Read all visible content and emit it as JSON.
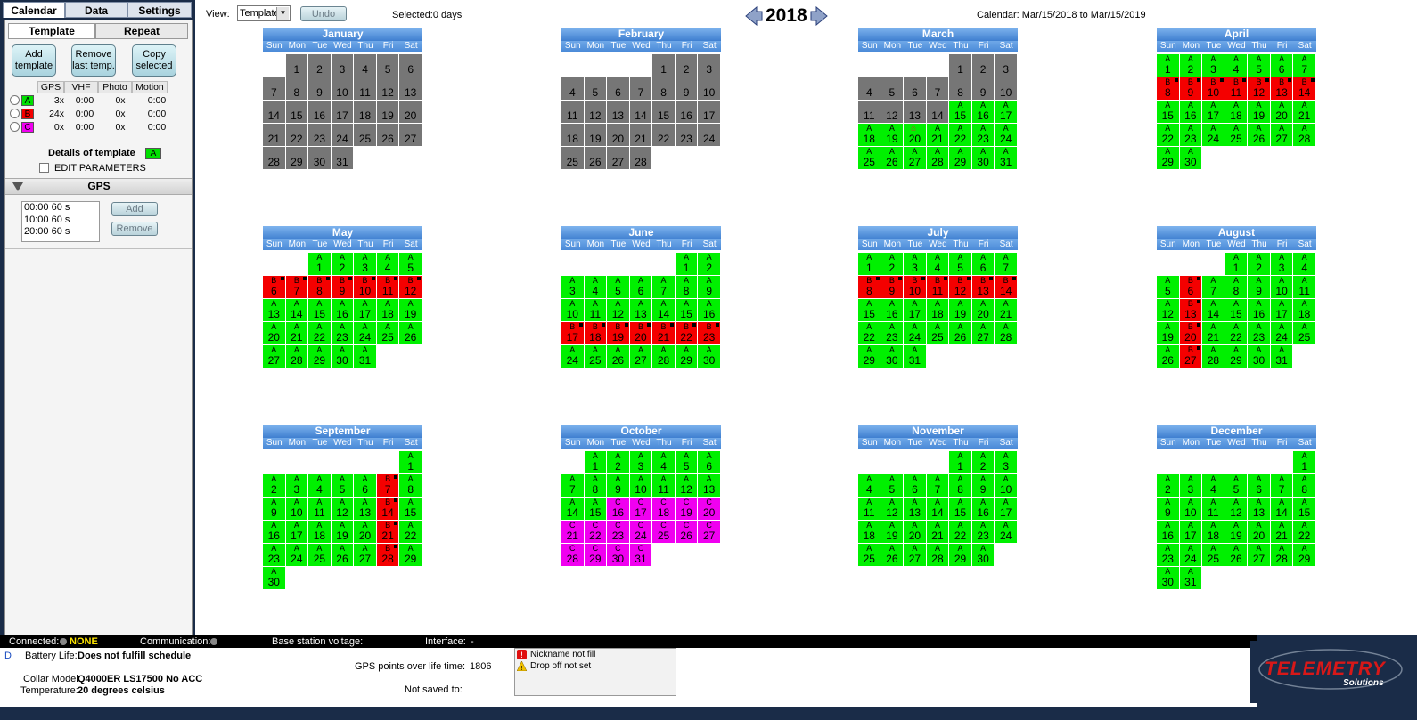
{
  "top_tabs": [
    "Calendar",
    "Data",
    "Settings"
  ],
  "left": {
    "subtabs": [
      "Template",
      "Repeat"
    ],
    "buttons": {
      "add": "Add template",
      "remove": "Remove last temp.",
      "copy": "Copy selected"
    },
    "columns": [
      "GPS",
      "VHF",
      "Photo",
      "Motion"
    ],
    "templates": [
      {
        "letter": "A",
        "color": "#00e000",
        "gps": "3x",
        "vhf": "0:00",
        "photo": "0x",
        "motion": "0:00"
      },
      {
        "letter": "B",
        "color": "#f40000",
        "gps": "24x",
        "vhf": "0:00",
        "photo": "0x",
        "motion": "0:00"
      },
      {
        "letter": "C",
        "color": "#f000f0",
        "gps": "0x",
        "vhf": "0:00",
        "photo": "0x",
        "motion": "0:00"
      }
    ],
    "details_label": "Details of template",
    "details_letter": "A",
    "edit_params": "EDIT PARAMETERS",
    "gps_header": "GPS",
    "gps_list": [
      "00:00  60 s",
      "10:00  60 s",
      "20:00  60 s"
    ],
    "add_btn": "Add",
    "remove_btn": "Remove"
  },
  "toolbar": {
    "view_label": "View:",
    "view_value": "Template",
    "undo": "Undo",
    "selected": "Selected:0 days",
    "year": "2018",
    "calendar_range": "Calendar: Mar/15/2018 to Mar/15/2019"
  },
  "weekdays": [
    "Sun",
    "Mon",
    "Tue",
    "Wed",
    "Thu",
    "Fri",
    "Sat"
  ],
  "months": [
    {
      "name": "January",
      "start": 1,
      "days": 31,
      "pattern": "xxxxxxxxxxxxxxxxxxxxxxxxxxxxxxx"
    },
    {
      "name": "February",
      "start": 4,
      "days": 28,
      "pattern": "xxxxxxxxxxxxxxxxxxxxxxxxxxxx"
    },
    {
      "name": "March",
      "start": 4,
      "days": 31,
      "pattern": "xxxxxxxxxxxxxxAAAAAAAAAAAAAAAAA"
    },
    {
      "name": "April",
      "start": 0,
      "days": 30,
      "pattern": "AAAAAAABBBBBBBAAAAAAAAAAAAAAAA"
    },
    {
      "name": "May",
      "start": 2,
      "days": 31,
      "pattern": "AAAAABBBBBBBAAAAAAAAAAAAAAAAAAA"
    },
    {
      "name": "June",
      "start": 5,
      "days": 30,
      "pattern": "AAAAAAAAAAAAAAAABBBBBBBAAAAAAA"
    },
    {
      "name": "July",
      "start": 0,
      "days": 31,
      "pattern": "AAAAAAABBBBBBBAAAAAAAAAAAAAAAAA"
    },
    {
      "name": "August",
      "start": 3,
      "days": 31,
      "pattern": "AAAAABAAAAAABAAAAAABAAAAAABAAAA"
    },
    {
      "name": "September",
      "start": 6,
      "days": 30,
      "pattern": "AAAAAABAAAAAABAAAAAABAAAAAABAA"
    },
    {
      "name": "October",
      "start": 1,
      "days": 31,
      "pattern": "AAAAAAAAAAAAAAACCCCCCCCCCCCCCCC"
    },
    {
      "name": "November",
      "start": 4,
      "days": 30,
      "pattern": "AAAAAAAAAAAAAAAAAAAAAAAAAAAAAA"
    },
    {
      "name": "December",
      "start": 6,
      "days": 31,
      "pattern": "AAAAAAAAAAAAAAAAAAAAAAAAAAAAAAA"
    }
  ],
  "status": {
    "connected_label": "Connected:",
    "connected_value": "NONE",
    "communication_label": "Communication:",
    "base_voltage_label": "Base station voltage:",
    "interface_label": "Interface:",
    "interface_value": "-",
    "d_marker": "D",
    "battery_label": "Battery Life:",
    "battery_value": "Does not fulfill schedule",
    "gps_points_label": "GPS points over life time:",
    "gps_points_value": "1806",
    "collar_label": "Collar Model:",
    "collar_value": "Q4000ER LS17500 No ACC",
    "temperature_label": "Temperature:",
    "temperature_value": "20 degrees celsius",
    "not_saved_label": "Not saved to:",
    "warnings": [
      "Nickname not fill",
      "Drop off not set"
    ]
  },
  "logo": {
    "text": "TELEMETRY",
    "sub": "Solutions"
  }
}
